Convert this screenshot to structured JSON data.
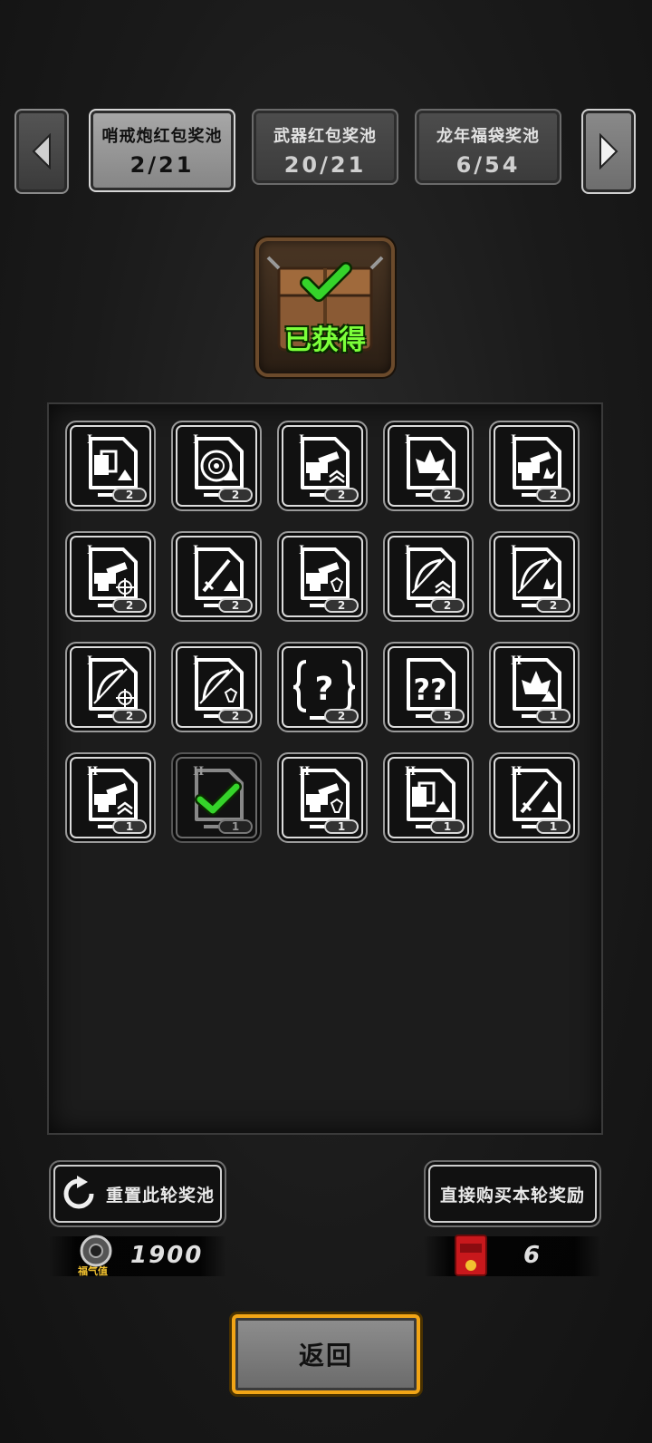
{
  "tabs": [
    {
      "name": "哨戒炮红包奖池",
      "count": "2/21"
    },
    {
      "name": "武器红包奖池",
      "count": "20/21"
    },
    {
      "name": "龙年福袋奖池",
      "count": "6/54"
    }
  ],
  "chest": {
    "label": "已获得"
  },
  "cards": [
    {
      "tier": "I",
      "icon": "cards-upgrade-icon",
      "count": "2"
    },
    {
      "tier": "I",
      "icon": "target-rings-upgrade-icon",
      "count": "2"
    },
    {
      "tier": "I",
      "icon": "turret-chevrons-icon",
      "count": "2"
    },
    {
      "tier": "I",
      "icon": "leaf-upgrade-icon",
      "count": "2"
    },
    {
      "tier": "I",
      "icon": "turret-burst-icon",
      "count": "2"
    },
    {
      "tier": "I",
      "icon": "turret-crosshair-icon",
      "count": "2"
    },
    {
      "tier": "I",
      "icon": "sword-upgrade-icon",
      "count": "2"
    },
    {
      "tier": "I",
      "icon": "turret-shield-icon",
      "count": "2"
    },
    {
      "tier": "I",
      "icon": "bow-chevrons-icon",
      "count": "2"
    },
    {
      "tier": "I",
      "icon": "bow-burst-icon",
      "count": "2"
    },
    {
      "tier": "I",
      "icon": "bow-crosshair-icon",
      "count": "2"
    },
    {
      "tier": "I",
      "icon": "bow-shield-icon",
      "count": "2"
    },
    {
      "tier": "",
      "icon": "mystery-bracket-icon",
      "count": "2"
    },
    {
      "tier": "",
      "icon": "mystery-double-icon",
      "count": "5"
    },
    {
      "tier": "II",
      "icon": "leaf-upgrade-icon",
      "count": "1"
    },
    {
      "tier": "II",
      "icon": "turret-chevrons-icon",
      "count": "1"
    },
    {
      "tier": "II",
      "icon": "obtained-check-icon",
      "count": "1",
      "obtained": true
    },
    {
      "tier": "II",
      "icon": "turret-shield-icon",
      "count": "1"
    },
    {
      "tier": "II",
      "icon": "cards-upgrade-icon",
      "count": "1"
    },
    {
      "tier": "II",
      "icon": "sword-upgrade-icon",
      "count": "1"
    }
  ],
  "actions": {
    "reset_label": "重置此轮奖池",
    "buy_label": "直接购买本轮奖励"
  },
  "currency": {
    "fortune_label": "福气值",
    "fortune_value": "1900",
    "redpack_value": "6"
  },
  "back_label": "返回",
  "colors": {
    "obtained_green": "#35d42a",
    "back_border": "#f2a516"
  }
}
